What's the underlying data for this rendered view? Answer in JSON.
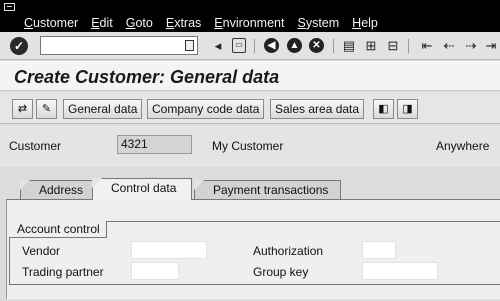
{
  "menubar": {
    "items": [
      "Customer",
      "Edit",
      "Goto",
      "Extras",
      "Environment",
      "System",
      "Help"
    ]
  },
  "toolbar": {
    "command_field_value": "",
    "icons": [
      "enter-icon",
      "back-arrow-icon",
      "save-icon",
      "back-icon",
      "exit-icon",
      "cancel-icon",
      "print-icon",
      "find-icon",
      "find-next-icon",
      "first-page-icon",
      "previous-page-icon",
      "next-page-icon"
    ]
  },
  "title": "Create Customer: General data",
  "app_toolbar": {
    "buttons": [
      "General data",
      "Company code data",
      "Sales area data"
    ]
  },
  "header": {
    "customer_label": "Customer",
    "customer_number": "4321",
    "customer_name": "My Customer",
    "customer_city": "Anywhere"
  },
  "tabs": [
    {
      "label": "Address",
      "active": false
    },
    {
      "label": "Control data",
      "active": true
    },
    {
      "label": "Payment transactions",
      "active": false
    }
  ],
  "account_control": {
    "title": "Account control",
    "fields": [
      {
        "label": "Vendor",
        "value": ""
      },
      {
        "label": "Trading partner",
        "value": ""
      },
      {
        "label": "Authorization",
        "value": ""
      },
      {
        "label": "Group key",
        "value": ""
      }
    ]
  },
  "colors": {
    "menubar_bg": "#000000",
    "screen_bg": "#dcdcdc",
    "title_bg": "#f4f4f4"
  }
}
